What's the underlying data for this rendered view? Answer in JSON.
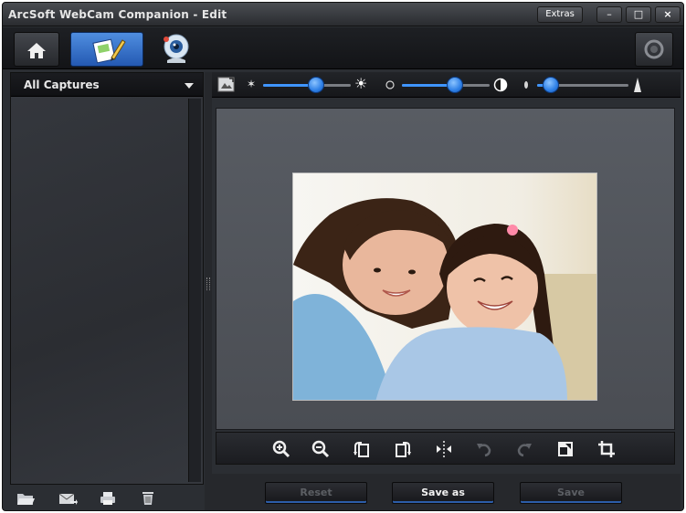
{
  "window": {
    "title": "ArcSoft WebCam Companion - Edit",
    "extras_label": "Extras",
    "minimize_label": "–",
    "maximize_label": "□",
    "close_label": "×"
  },
  "toolbar": {
    "tools": [
      {
        "name": "home",
        "icon": "home-icon"
      },
      {
        "name": "edit",
        "icon": "edit-icon",
        "active": true
      },
      {
        "name": "webcam",
        "icon": "webcam-icon"
      }
    ],
    "help_icon": "help-icon"
  },
  "left_panel": {
    "captures_dropdown": "All Captures",
    "bottom_icons": [
      "open-folder-icon",
      "email-icon",
      "print-icon",
      "delete-icon"
    ]
  },
  "adjustments": {
    "brightness": 0.6,
    "contrast": 0.6,
    "sharpness": 0.15
  },
  "edit_toolbar": {
    "icons": [
      "zoom-in-icon",
      "zoom-out-icon",
      "rotate-left-icon",
      "rotate-right-icon",
      "flip-icon",
      "undo-icon",
      "redo-icon",
      "fit-icon",
      "crop-icon"
    ]
  },
  "buttons": {
    "reset": "Reset",
    "save_as": "Save as",
    "save": "Save"
  },
  "colors": {
    "accent": "#3f95ff",
    "panel": "#2b2e33"
  }
}
